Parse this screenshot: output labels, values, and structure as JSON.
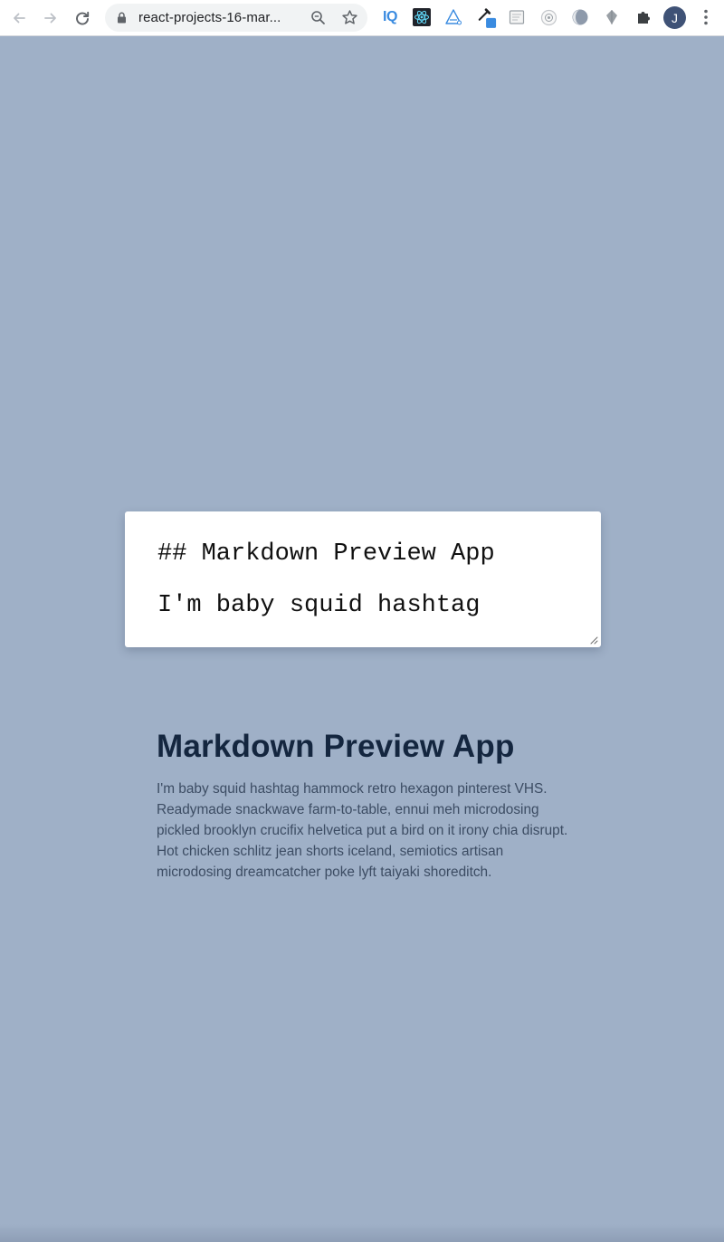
{
  "browser": {
    "url": "react-projects-16-mar...",
    "profile_initial": "J",
    "extensions": [
      {
        "name": "iq-extension-icon",
        "label": "IQ"
      },
      {
        "name": "react-devtools-icon"
      },
      {
        "name": "testing-extension-icon"
      },
      {
        "name": "color-picker-icon"
      },
      {
        "name": "page-extension-icon"
      },
      {
        "name": "circle-extension-icon"
      },
      {
        "name": "edge-extension-icon"
      },
      {
        "name": "diamond-extension-icon"
      },
      {
        "name": "extensions-puzzle-icon"
      }
    ]
  },
  "editor": {
    "lines": [
      "## Markdown Preview App",
      "I'm baby squid hashtag"
    ]
  },
  "preview": {
    "heading": "Markdown Preview App",
    "paragraph": "I'm baby squid hashtag hammock retro hexagon pinterest VHS. Readymade snackwave farm-to-table, ennui meh microdosing pickled brooklyn crucifix helvetica put a bird on it irony chia disrupt. Hot chicken schlitz jean shorts iceland, semiotics artisan microdosing dreamcatcher poke lyft taiyaki shoreditch."
  },
  "colors": {
    "page_background": "#9fb0c7",
    "heading": "#14263f",
    "body_text": "#3c4c63",
    "accent_blue": "#3a8be0"
  }
}
